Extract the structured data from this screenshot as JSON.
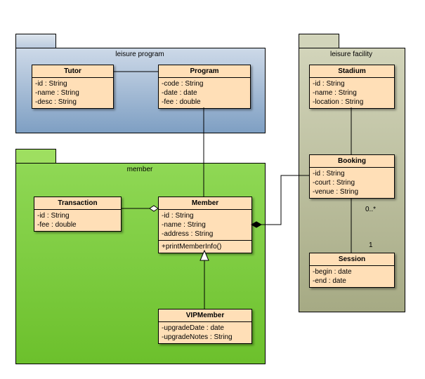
{
  "packages": {
    "leisure_program": "leisure program",
    "member": "member",
    "leisure_facility": "leisure facility"
  },
  "classes": {
    "tutor": {
      "name": "Tutor",
      "attrs": [
        "-id : String",
        "-name : String",
        "-desc : String"
      ]
    },
    "program": {
      "name": "Program",
      "attrs": [
        "-code : String",
        "-date : date",
        "-fee : double"
      ]
    },
    "transaction": {
      "name": "Transaction",
      "attrs": [
        "-id : String",
        "-fee : double"
      ]
    },
    "member": {
      "name": "Member",
      "attrs": [
        "-id : String",
        "-name : String",
        "-address : String"
      ],
      "ops": [
        "+printMemberInfo()"
      ]
    },
    "vipmember": {
      "name": "VIPMember",
      "attrs": [
        "-upgradeDate : date",
        "-upgradeNotes : String"
      ]
    },
    "stadium": {
      "name": "Stadium",
      "attrs": [
        "-id : String",
        "-name : String",
        "-location : String"
      ]
    },
    "booking": {
      "name": "Booking",
      "attrs": [
        "-id : String",
        "-court : String",
        "-venue : String"
      ]
    },
    "session": {
      "name": "Session",
      "attrs": [
        "-begin : date",
        "-end : date"
      ]
    }
  },
  "multiplicities": {
    "booking_session_top": "0..*",
    "booking_session_bottom": "1"
  }
}
